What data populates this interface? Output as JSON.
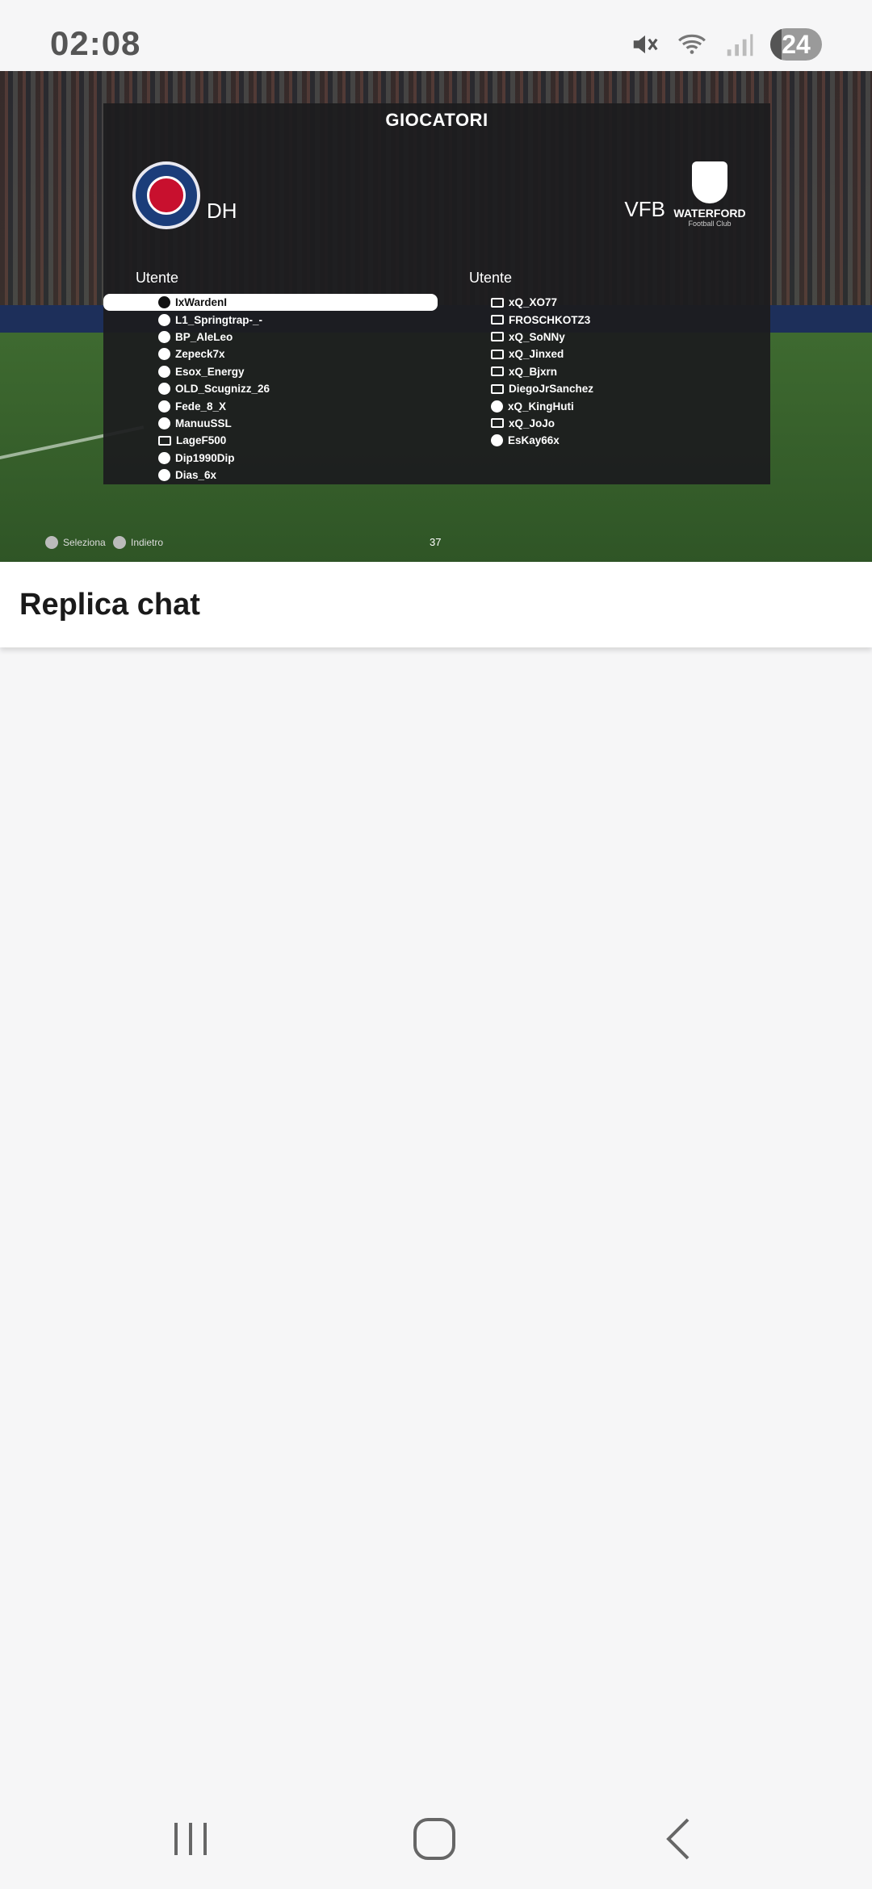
{
  "status_bar": {
    "time": "02:08",
    "battery": "24",
    "icons": [
      "mute-icon",
      "wifi-icon",
      "signal-icon",
      "battery-icon"
    ]
  },
  "game": {
    "panel_title": "GIOCATORI",
    "left_team": {
      "code": "DH",
      "crest": "PARIS"
    },
    "right_team": {
      "code": "VFB",
      "crest_name": "WATERFORD",
      "crest_sub": "Football Club"
    },
    "left_header": "Utente",
    "right_header": "Utente",
    "left_players": [
      "IxWardenI",
      "L1_Springtrap-_-",
      "BP_AleLeo",
      "Zepeck7x",
      "Esox_Energy",
      "OLD_Scugnizz_26",
      "Fede_8_X",
      "ManuuSSL",
      "LageF500",
      "Dip1990Dip",
      "Dias_6x"
    ],
    "right_players": [
      "xQ_XO77",
      "FROSCHKOTZ3",
      "xQ_SoNNy",
      "xQ_Jinxed",
      "xQ_Bjxrn",
      "DiegoJrSanchez",
      "xQ_KingHuti",
      "xQ_JoJo",
      "EsKay66x"
    ],
    "hint_select": "Seleziona",
    "hint_back": "Indietro",
    "counter": "37"
  },
  "title": "Replica chat"
}
